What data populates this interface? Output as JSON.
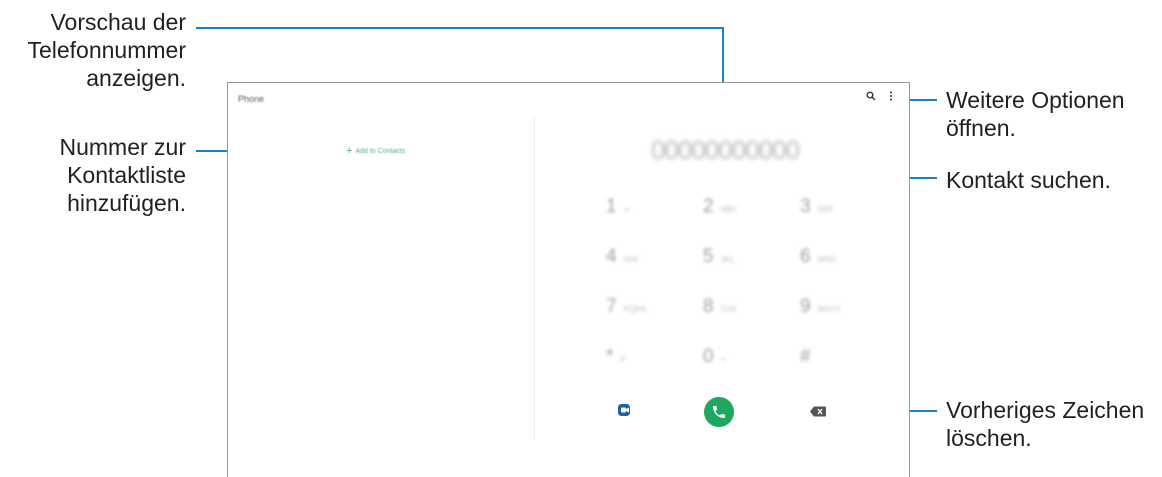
{
  "callouts": {
    "preview": [
      "Vorschau der",
      "Telefonnummer",
      "anzeigen."
    ],
    "add_contact": [
      "Nummer zur",
      "Kontaktliste",
      "hinzufügen."
    ],
    "more_options": [
      "Weitere Optionen",
      "öffnen."
    ],
    "search": [
      "Kontakt suchen."
    ],
    "delete": [
      "Vorheriges Zeichen",
      "löschen."
    ]
  },
  "app": {
    "title": "Phone",
    "add_to_contacts": "Add to Contacts",
    "number_display": "00000000000",
    "keypad": [
      {
        "digit": "1",
        "letters": "∞"
      },
      {
        "digit": "2",
        "letters": "ABC"
      },
      {
        "digit": "3",
        "letters": "DEF"
      },
      {
        "digit": "4",
        "letters": "GHI"
      },
      {
        "digit": "5",
        "letters": "JKL"
      },
      {
        "digit": "6",
        "letters": "MNO"
      },
      {
        "digit": "7",
        "letters": "PQRS"
      },
      {
        "digit": "8",
        "letters": "TUV"
      },
      {
        "digit": "9",
        "letters": "WXYZ"
      },
      {
        "digit": "*",
        "letters": "P"
      },
      {
        "digit": "0",
        "letters": "+"
      },
      {
        "digit": "#",
        "letters": ""
      }
    ]
  },
  "icons": {
    "search": "search-icon",
    "more": "more-options-icon",
    "video": "video-call-icon",
    "call": "phone-call-icon",
    "backspace": "backspace-icon"
  },
  "colors": {
    "callout_line": "#1a82c4",
    "call_button": "#1fa65f",
    "video_icon": "#1e5fa6",
    "add_contact_green": "#4caf7a"
  }
}
